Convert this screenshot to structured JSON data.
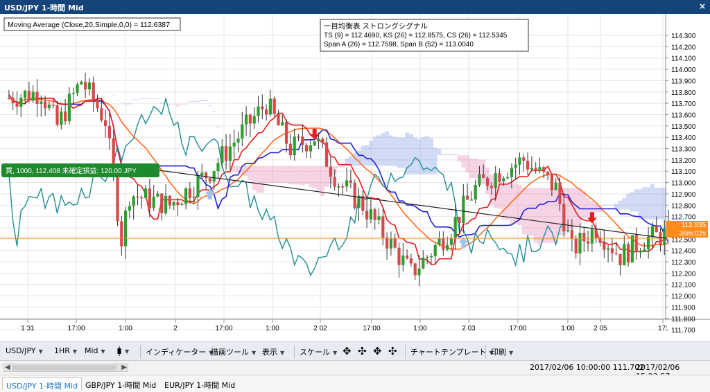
{
  "window": {
    "title": "USD/JPY 1-時間 Mid",
    "close_label": "×"
  },
  "indicator_box": {
    "text": "Moving Average (Close,20,Simple,0,0) = 112.6387"
  },
  "ichimoku_box": {
    "line1": "一目均衡表 ストロングシグナル",
    "line2": "TS (9) = 112.4690, KS (26) = 112.8575, CS (26) = 112.5345",
    "line3": "Span A (26) = 112.7598, Span B (52) = 113.0040"
  },
  "position_label": "買, 1000, 112.408 未確定損益: 120.00 JPY",
  "price_tag": {
    "price": "112.535",
    "countdown": "36m:02s"
  },
  "price_axis": [
    "114.300",
    "114.200",
    "114.100",
    "114.000",
    "113.900",
    "113.800",
    "113.700",
    "113.600",
    "113.500",
    "113.400",
    "113.300",
    "113.200",
    "113.100",
    "113.000",
    "112.900",
    "112.800",
    "112.700",
    "112.600",
    "112.500",
    "112.400",
    "112.300",
    "112.200",
    "112.100",
    "112.000",
    "111.900",
    "111.800",
    "111.700"
  ],
  "time_axis": [
    "1 31",
    "17:00",
    "1:00",
    "2",
    "17:00",
    "1:00",
    "2 02",
    "17:00",
    "1:00",
    "2 03",
    "17:00",
    "1:00",
    "2 05",
    "17:"
  ],
  "toolbar": {
    "symbol": "USD/JPY",
    "timeframe": "1HR",
    "price_type": "Mid",
    "indicators": "インディケーター",
    "drawing_tools": "描画ツール",
    "display": "表示",
    "scale": "スケール",
    "template": "チャートテンプレート",
    "print": "印刷"
  },
  "status": {
    "left": "2017/02/06 10:00:00 111.702",
    "right": "2017/02/06 15:23:57"
  },
  "tabs": [
    "USD/JPY 1-時間 Mid",
    "GBP/JPY 1-時間 Mid",
    "EUR/JPY 1-時間 Mid"
  ],
  "colors": {
    "bull": "#2e9e2e",
    "bear": "#d84848",
    "ma20": "#ff6a1a",
    "tenkan": "#e81c1c",
    "kijun": "#1e1ed8",
    "chikou": "#1e8c96",
    "cloud_pink": "#e060a0",
    "cloud_blue": "#5a7ee0",
    "current_price": "#ff8c1a",
    "position_bg": "#1e8a2e"
  },
  "chart_data": {
    "type": "candlestick",
    "ylim": [
      111.7,
      114.3
    ],
    "bars": 165,
    "bar_ohlc_estimated": [
      [
        113.8,
        113.87,
        113.72,
        113.78
      ],
      [
        113.78,
        113.84,
        113.66,
        113.72
      ],
      [
        113.72,
        113.8,
        113.6,
        113.65
      ],
      [
        113.65,
        113.7,
        113.5,
        113.55
      ],
      [
        113.55,
        113.62,
        113.45,
        113.52
      ],
      [
        113.52,
        113.65,
        113.48,
        113.6
      ],
      [
        113.6,
        113.72,
        113.55,
        113.68
      ],
      [
        113.68,
        113.9,
        113.62,
        113.85
      ],
      [
        113.85,
        113.95,
        113.72,
        113.78
      ],
      [
        113.78,
        113.85,
        113.6,
        113.65
      ],
      [
        113.65,
        113.7,
        113.3,
        113.35
      ],
      [
        113.35,
        113.4,
        112.4,
        112.5
      ],
      [
        112.5,
        112.95,
        112.3,
        112.85
      ],
      [
        112.85,
        113.05,
        112.7,
        112.95
      ],
      [
        112.95,
        113.0,
        112.75,
        112.82
      ],
      [
        112.82,
        112.9,
        112.7,
        112.75
      ],
      [
        112.75,
        113.05,
        112.72,
        113.0
      ],
      [
        113.0,
        113.12,
        112.85,
        112.9
      ],
      [
        112.9,
        113.0,
        112.8,
        112.95
      ],
      [
        112.95,
        113.15,
        112.9,
        113.1
      ],
      [
        113.1,
        113.3,
        113.05,
        113.25
      ],
      [
        113.25,
        113.45,
        113.2,
        113.4
      ],
      [
        113.4,
        113.5,
        113.3,
        113.35
      ],
      [
        113.35,
        113.6,
        113.3,
        113.55
      ],
      [
        113.55,
        113.65,
        113.4,
        113.45
      ],
      [
        113.45,
        113.5,
        113.3,
        113.38
      ],
      [
        113.38,
        113.6,
        113.35,
        113.55
      ],
      [
        113.55,
        113.75,
        113.5,
        113.7
      ],
      [
        113.7,
        113.78,
        113.3,
        113.35
      ],
      [
        113.35,
        113.45,
        113.0,
        113.05
      ],
      [
        113.05,
        113.3,
        113.0,
        113.25
      ],
      [
        113.25,
        113.4,
        113.15,
        113.35
      ],
      [
        113.35,
        113.38,
        112.9,
        112.95
      ],
      [
        112.95,
        113.1,
        112.85,
        113.05
      ],
      [
        113.05,
        113.15,
        112.8,
        112.85
      ],
      [
        112.85,
        112.9,
        112.55,
        112.6
      ],
      [
        112.6,
        112.7,
        112.4,
        112.45
      ],
      [
        112.45,
        112.6,
        112.3,
        112.35
      ],
      [
        112.35,
        112.45,
        112.05,
        112.25
      ],
      [
        112.25,
        112.5,
        112.2,
        112.45
      ],
      [
        112.45,
        112.6,
        112.4,
        112.55
      ],
      [
        112.55,
        112.7,
        112.5,
        112.65
      ],
      [
        112.65,
        112.85,
        112.6,
        112.8
      ],
      [
        112.8,
        112.95,
        112.75,
        112.9
      ],
      [
        112.9,
        113.2,
        112.85,
        113.15
      ],
      [
        113.15,
        113.25,
        113.05,
        113.1
      ],
      [
        113.1,
        113.2,
        113.0,
        113.05
      ],
      [
        113.05,
        113.15,
        112.95,
        113.1
      ],
      [
        113.1,
        113.65,
        112.9,
        112.95
      ],
      [
        112.95,
        113.0,
        112.5,
        112.55
      ],
      [
        112.55,
        112.9,
        112.4,
        112.85
      ],
      [
        112.85,
        113.0,
        112.8,
        112.92
      ],
      [
        112.92,
        113.0,
        112.6,
        112.65
      ],
      [
        112.65,
        112.7,
        112.35,
        112.45
      ],
      [
        112.45,
        112.75,
        112.4,
        112.7
      ]
    ],
    "series": [
      {
        "name": "Moving Average (Close,20,Simple,0,0)",
        "last": 112.6387
      },
      {
        "name": "TS (9)",
        "last": 112.469
      },
      {
        "name": "KS (26)",
        "last": 112.8575
      },
      {
        "name": "CS (26)",
        "last": 112.5345
      },
      {
        "name": "Span A (26)",
        "last": 112.7598
      },
      {
        "name": "Span B (52)",
        "last": 113.004
      }
    ],
    "horizontal_lines": [
      {
        "value": 112.535,
        "color": "#ff8c1a"
      }
    ],
    "signals": [
      {
        "type": "sell",
        "bar": 76
      },
      {
        "type": "sell",
        "bar": 145
      },
      {
        "type": "buy",
        "bar": 50
      },
      {
        "type": "buy",
        "bar": 113
      }
    ]
  }
}
